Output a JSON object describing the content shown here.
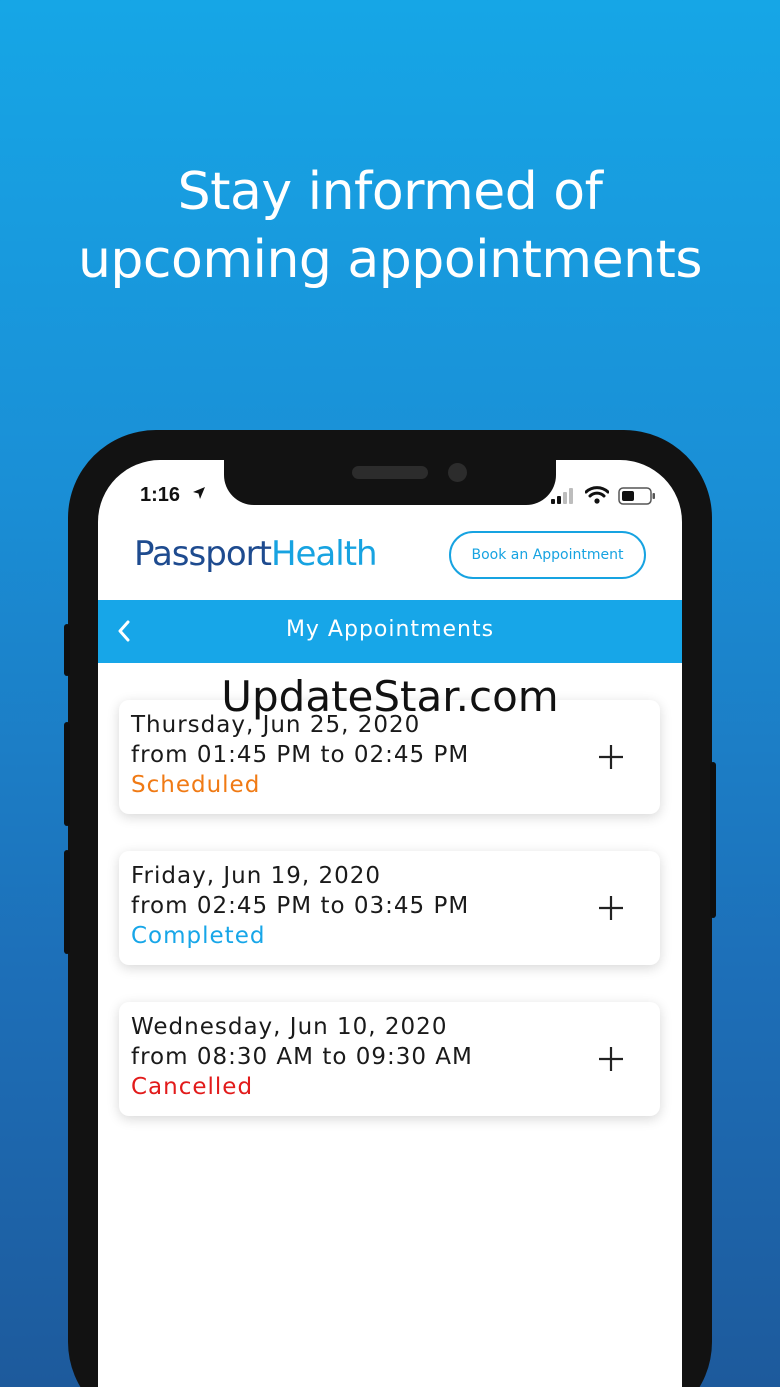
{
  "headline": {
    "line1": "Stay informed of",
    "line2": "upcoming appointments"
  },
  "status_bar": {
    "time": "1:16"
  },
  "header": {
    "brand_part1": "Passport",
    "brand_part2": "Health",
    "book_button": "Book an Appointment"
  },
  "navbar": {
    "title": "My Appointments"
  },
  "appointments": [
    {
      "date": "Thursday, Jun 25, 2020",
      "time": "from 01:45 PM to 02:45 PM",
      "status": "Scheduled",
      "status_color": "#f07a14"
    },
    {
      "date": "Friday, Jun 19, 2020",
      "time": "from 02:45 PM to 03:45 PM",
      "status": "Completed",
      "status_color": "#17a6e8"
    },
    {
      "date": "Wednesday, Jun 10, 2020",
      "time": "from 08:30 AM to 09:30 AM",
      "status": "Cancelled",
      "status_color": "#e21b1b"
    }
  ],
  "watermark": "UpdateStar.com",
  "colors": {
    "accent": "#17a6e8",
    "brand_dark": "#1e4b8f"
  }
}
